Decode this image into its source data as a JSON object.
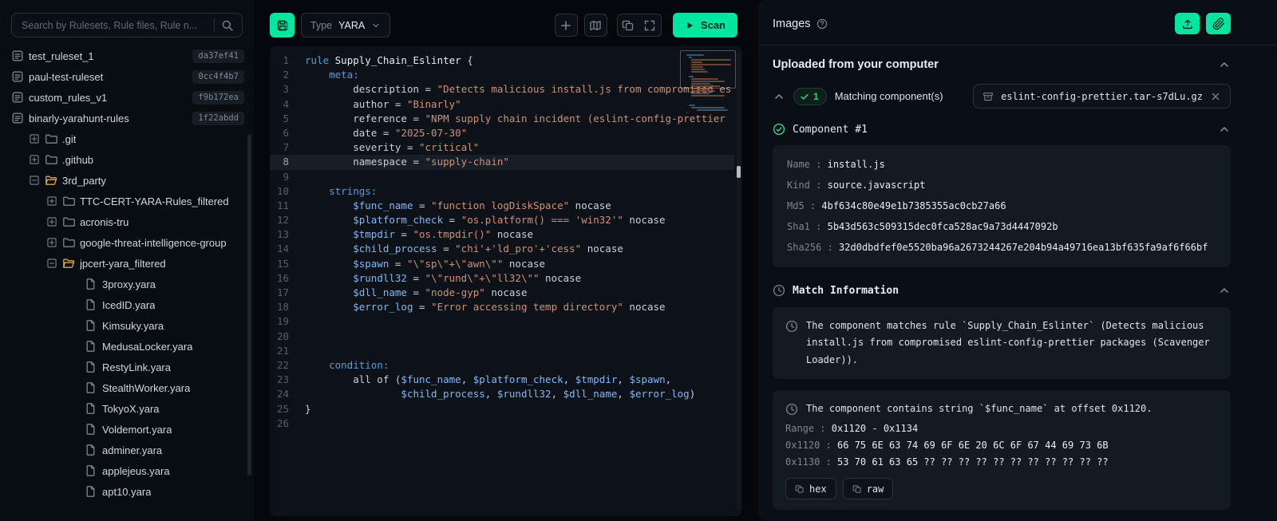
{
  "colors": {
    "accent_green": "#00e5a0",
    "badge_green": "#2fd493",
    "keyword_blue": "#569cd6",
    "string_orange": "#ce9178"
  },
  "sidebar": {
    "search_placeholder": "Search by Rulesets, Rule files, Rule n...",
    "items": [
      {
        "label": "test_ruleset_1",
        "badge": "da37ef41",
        "level": 0,
        "icon": "ruleset"
      },
      {
        "label": "paul-test-ruleset",
        "badge": "0cc4f4b7",
        "level": 0,
        "icon": "ruleset"
      },
      {
        "label": "custom_rules_v1",
        "badge": "f9b172ea",
        "level": 0,
        "icon": "ruleset"
      },
      {
        "label": "binarly-yarahunt-rules",
        "badge": "1f22abdd",
        "level": 0,
        "icon": "ruleset"
      },
      {
        "label": ".git",
        "level": 1,
        "expander": "plus",
        "icon": "folder"
      },
      {
        "label": ".github",
        "level": 1,
        "expander": "plus",
        "icon": "folder"
      },
      {
        "label": "3rd_party",
        "level": 1,
        "expander": "minus",
        "icon": "folder-open"
      },
      {
        "label": "TTC-CERT-YARA-Rules_filtered",
        "level": 2,
        "expander": "plus",
        "icon": "folder"
      },
      {
        "label": "acronis-tru",
        "level": 2,
        "expander": "plus",
        "icon": "folder"
      },
      {
        "label": "google-threat-intelligence-group",
        "level": 2,
        "expander": "plus",
        "icon": "folder"
      },
      {
        "label": "jpcert-yara_filtered",
        "level": 2,
        "expander": "minus",
        "icon": "folder-open"
      },
      {
        "label": "3proxy.yara",
        "level": 3,
        "icon": "file"
      },
      {
        "label": "IcedID.yara",
        "level": 3,
        "icon": "file"
      },
      {
        "label": "Kimsuky.yara",
        "level": 3,
        "icon": "file"
      },
      {
        "label": "MedusaLocker.yara",
        "level": 3,
        "icon": "file"
      },
      {
        "label": "RestyLink.yara",
        "level": 3,
        "icon": "file"
      },
      {
        "label": "StealthWorker.yara",
        "level": 3,
        "icon": "file"
      },
      {
        "label": "TokyoX.yara",
        "level": 3,
        "icon": "file"
      },
      {
        "label": "Voldemort.yara",
        "level": 3,
        "icon": "file"
      },
      {
        "label": "adminer.yara",
        "level": 3,
        "icon": "file"
      },
      {
        "label": "applejeus.yara",
        "level": 3,
        "icon": "file"
      },
      {
        "label": "apt10.yara",
        "level": 3,
        "icon": "file"
      }
    ]
  },
  "editor": {
    "toolbar": {
      "type_label": "Type",
      "type_value": "YARA",
      "scan_label": "Scan"
    },
    "highlighted_line": 8,
    "lines": [
      {
        "n": 1,
        "s": [
          [
            "kw",
            "rule "
          ],
          [
            "id",
            "Supply_Chain_Eslinter "
          ],
          [
            "pl",
            "{"
          ]
        ]
      },
      {
        "n": 2,
        "s": [
          [
            "pl",
            "    "
          ],
          [
            "kw",
            "meta:"
          ]
        ]
      },
      {
        "n": 3,
        "s": [
          [
            "pl",
            "        "
          ],
          [
            "pr",
            "description"
          ],
          [
            "op",
            " = "
          ],
          [
            "st",
            "\"Detects malicious install.js from compromised es"
          ]
        ]
      },
      {
        "n": 4,
        "s": [
          [
            "pl",
            "        "
          ],
          [
            "pr",
            "author"
          ],
          [
            "op",
            " = "
          ],
          [
            "st",
            "\"Binarly\""
          ]
        ]
      },
      {
        "n": 5,
        "s": [
          [
            "pl",
            "        "
          ],
          [
            "pr",
            "reference"
          ],
          [
            "op",
            " = "
          ],
          [
            "st",
            "\"NPM supply chain incident (eslint-config-prettier"
          ]
        ]
      },
      {
        "n": 6,
        "s": [
          [
            "pl",
            "        "
          ],
          [
            "pr",
            "date"
          ],
          [
            "op",
            " = "
          ],
          [
            "st",
            "\"2025-07-30\""
          ]
        ]
      },
      {
        "n": 7,
        "s": [
          [
            "pl",
            "        "
          ],
          [
            "pr",
            "severity"
          ],
          [
            "op",
            " = "
          ],
          [
            "st",
            "\"critical\""
          ]
        ]
      },
      {
        "n": 8,
        "hl": true,
        "s": [
          [
            "pl",
            "        "
          ],
          [
            "pr",
            "namespace"
          ],
          [
            "op",
            " = "
          ],
          [
            "st",
            "\"supply-chain\""
          ]
        ]
      },
      {
        "n": 9,
        "s": []
      },
      {
        "n": 10,
        "s": [
          [
            "pl",
            "    "
          ],
          [
            "kw",
            "strings:"
          ]
        ]
      },
      {
        "n": 11,
        "s": [
          [
            "pl",
            "        "
          ],
          [
            "vr",
            "$func_name"
          ],
          [
            "op",
            " = "
          ],
          [
            "st",
            "\"function logDiskSpace\""
          ],
          [
            "pl",
            " nocase"
          ]
        ]
      },
      {
        "n": 12,
        "s": [
          [
            "pl",
            "        "
          ],
          [
            "vr",
            "$platform_check"
          ],
          [
            "op",
            " = "
          ],
          [
            "st",
            "\"os.platform() === 'win32'\""
          ],
          [
            "pl",
            " nocase"
          ]
        ]
      },
      {
        "n": 13,
        "s": [
          [
            "pl",
            "        "
          ],
          [
            "vr",
            "$tmpdir"
          ],
          [
            "op",
            " = "
          ],
          [
            "st",
            "\"os.tmpdir()\""
          ],
          [
            "pl",
            " nocase"
          ]
        ]
      },
      {
        "n": 14,
        "s": [
          [
            "pl",
            "        "
          ],
          [
            "vr",
            "$child_process"
          ],
          [
            "op",
            " = "
          ],
          [
            "st",
            "\"chi'+'ld_pro'+'cess\""
          ],
          [
            "pl",
            " nocase"
          ]
        ]
      },
      {
        "n": 15,
        "s": [
          [
            "pl",
            "        "
          ],
          [
            "vr",
            "$spawn"
          ],
          [
            "op",
            " = "
          ],
          [
            "st",
            "\"\\\"sp\\\"+\\\"awn\\\"\""
          ],
          [
            "pl",
            " nocase"
          ]
        ]
      },
      {
        "n": 16,
        "s": [
          [
            "pl",
            "        "
          ],
          [
            "vr",
            "$rundll32"
          ],
          [
            "op",
            " = "
          ],
          [
            "st",
            "\"\\\"rund\\\"+\\\"ll32\\\"\""
          ],
          [
            "pl",
            " nocase"
          ]
        ]
      },
      {
        "n": 17,
        "s": [
          [
            "pl",
            "        "
          ],
          [
            "vr",
            "$dll_name"
          ],
          [
            "op",
            " = "
          ],
          [
            "st",
            "\"node-gyp\""
          ],
          [
            "pl",
            " nocase"
          ]
        ]
      },
      {
        "n": 18,
        "s": [
          [
            "pl",
            "        "
          ],
          [
            "vr",
            "$error_log"
          ],
          [
            "op",
            " = "
          ],
          [
            "st",
            "\"Error accessing temp directory\""
          ],
          [
            "pl",
            " nocase"
          ]
        ]
      },
      {
        "n": 19,
        "s": []
      },
      {
        "n": 20,
        "s": []
      },
      {
        "n": 21,
        "s": []
      },
      {
        "n": 22,
        "s": [
          [
            "pl",
            "    "
          ],
          [
            "kw",
            "condition:"
          ]
        ]
      },
      {
        "n": 23,
        "s": [
          [
            "pl",
            "        all of ("
          ],
          [
            "vr",
            "$func_name"
          ],
          [
            "pl",
            ", "
          ],
          [
            "vr",
            "$platform_check"
          ],
          [
            "pl",
            ", "
          ],
          [
            "vr",
            "$tmpdir"
          ],
          [
            "pl",
            ", "
          ],
          [
            "vr",
            "$spawn"
          ],
          [
            "pl",
            ","
          ]
        ]
      },
      {
        "n": 24,
        "s": [
          [
            "pl",
            "                "
          ],
          [
            "vr",
            "$child_process"
          ],
          [
            "pl",
            ", "
          ],
          [
            "vr",
            "$rundll32"
          ],
          [
            "pl",
            ", "
          ],
          [
            "vr",
            "$dll_name"
          ],
          [
            "pl",
            ", "
          ],
          [
            "vr",
            "$error_log"
          ],
          [
            "pl",
            ")"
          ]
        ]
      },
      {
        "n": 25,
        "s": [
          [
            "pl",
            "}"
          ]
        ]
      },
      {
        "n": 26,
        "s": []
      }
    ]
  },
  "inspector": {
    "title": "Images",
    "uploaded_title": "Uploaded from your computer",
    "matching_count": "1",
    "matching_label": "Matching component(s)",
    "file_name": "eslint-config-prettier.tar-s7dLu.gz",
    "component_title": "Component #1",
    "fields": [
      {
        "label": "Name",
        "value": "install.js"
      },
      {
        "label": "Kind",
        "value": "source.javascript"
      },
      {
        "label": "Md5",
        "value": "4bf634c80e49e1b7385355ac0cb27a66"
      },
      {
        "label": "Sha1",
        "value": "5b43d563c509315dec0fca528ac9a73d4447092b"
      },
      {
        "label": "Sha256",
        "value": "32d0dbdfef0e5520ba96a2673244267e204b94a49716ea13bf635fa9af6f66bf"
      }
    ],
    "match_info_title": "Match Information",
    "match_text": "The component matches rule `Supply_Chain_Eslinter` (Detects malicious install.js from compromised eslint-config-prettier packages (Scavenger Loader)).",
    "contains_text": "The component contains string `$func_name` at offset 0x1120.",
    "hex_rows": [
      {
        "label": "Range",
        "value": "0x1120 - 0x1134"
      },
      {
        "label": "0x1120",
        "value": "66 75 6E 63 74 69 6F 6E 20 6C 6F 67 44 69 73 6B"
      },
      {
        "label": "0x1130",
        "value": "53 70 61 63 65 ?? ?? ?? ?? ?? ?? ?? ?? ?? ?? ??"
      }
    ],
    "hex_buttons": [
      "hex",
      "raw"
    ]
  }
}
